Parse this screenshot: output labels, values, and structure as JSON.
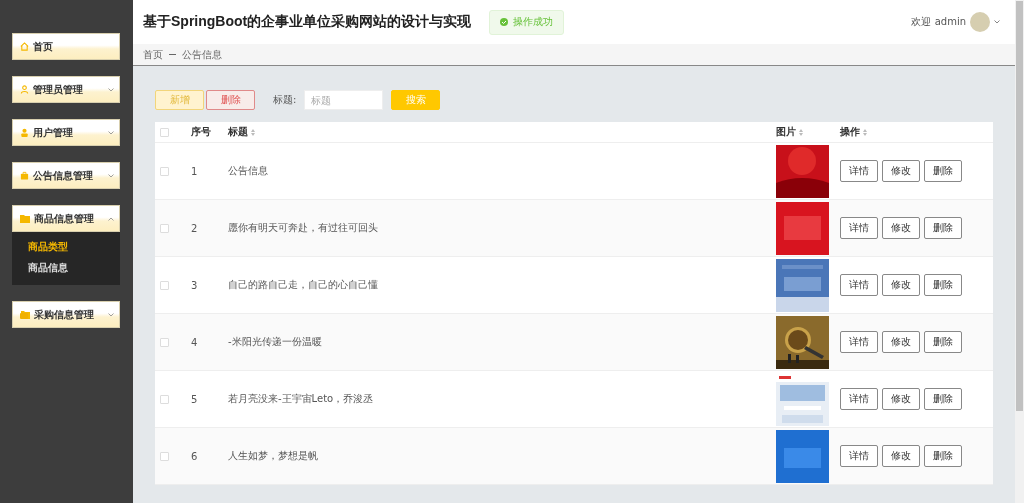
{
  "sidebar": {
    "items": [
      {
        "label": "首页",
        "selected": false
      },
      {
        "label": "管理员管理",
        "expanded": false,
        "selected": false
      },
      {
        "label": "用户管理",
        "expanded": false,
        "selected": false
      },
      {
        "label": "公告信息管理",
        "expanded": false,
        "selected": false
      },
      {
        "label": "商品信息管理",
        "expanded": true,
        "selected": false,
        "children": [
          {
            "label": "商品类型",
            "selected": true
          },
          {
            "label": "商品信息",
            "selected": false
          }
        ]
      },
      {
        "label": "采购信息管理",
        "expanded": false,
        "selected": false
      }
    ]
  },
  "header": {
    "title": "基于SpringBoot的企事业单位采购网站的设计与实现",
    "toast": "操作成功",
    "welcome": "欢迎 admin"
  },
  "breadcrumb": [
    "首页",
    "公告信息"
  ],
  "toolbar": {
    "add": "新增",
    "delete": "删除",
    "search_label": "标题:",
    "search_placeholder": "标题",
    "search_button": "搜索"
  },
  "table": {
    "checked": false,
    "columns": [
      "序号",
      "标题",
      "图片",
      "操作"
    ],
    "rows": [
      {
        "index": "1",
        "title": "公告信息",
        "checked": false,
        "picture": {
          "kind": "picture"
        },
        "actions": [
          "详情",
          "修改",
          "删除"
        ]
      },
      {
        "index": "2",
        "title": "愿你有明天可奔赴，有过往可回头",
        "checked": false,
        "picture": {
          "kind": "picture"
        },
        "actions": [
          "详情",
          "修改",
          "删除"
        ]
      },
      {
        "index": "3",
        "title": "自己的路自己走，自己的心自己懂",
        "checked": false,
        "picture": {
          "kind": "picture"
        },
        "actions": [
          "详情",
          "修改",
          "删除"
        ]
      },
      {
        "index": "4",
        "title": "-米阳光传递一份温暖",
        "checked": false,
        "picture": {
          "kind": "picture"
        },
        "actions": [
          "详情",
          "修改",
          "删除"
        ]
      },
      {
        "index": "5",
        "title": "若月亮没来-王宇宙Leto，乔浚丞",
        "checked": false,
        "picture": {
          "kind": "picture"
        },
        "actions": [
          "详情",
          "修改",
          "删除"
        ]
      },
      {
        "index": "6",
        "title": "人生如梦，梦想是帆",
        "checked": false,
        "picture": {
          "kind": "picture"
        },
        "actions": [
          "详情",
          "修改",
          "删除"
        ]
      }
    ]
  }
}
